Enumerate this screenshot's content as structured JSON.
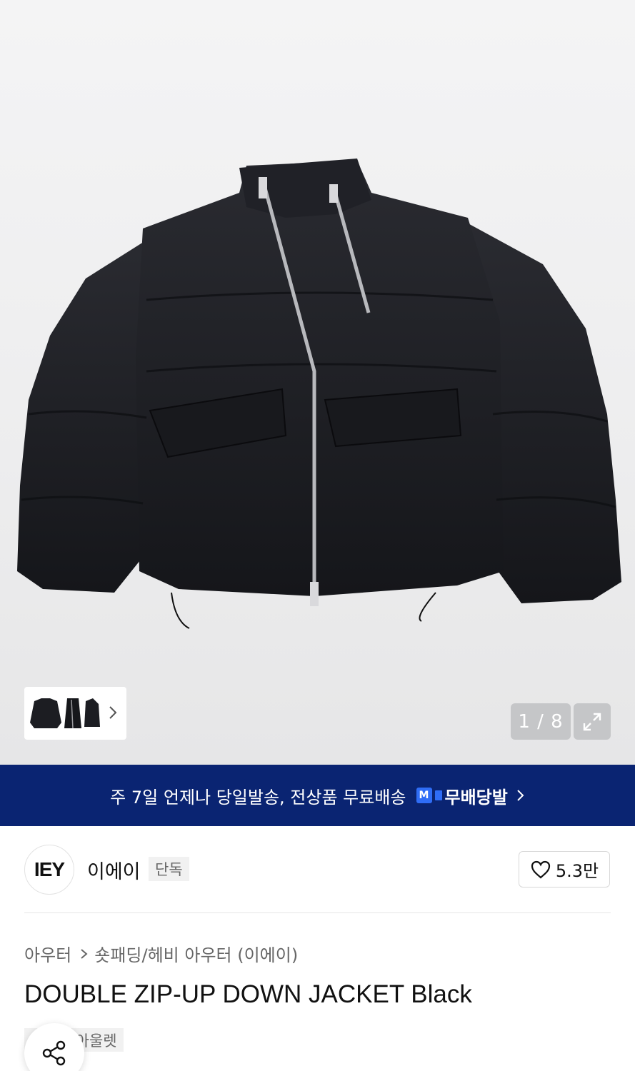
{
  "gallery": {
    "counter": "1 / 8",
    "thumbnails": [
      "thumb-front",
      "thumb-side",
      "thumb-back"
    ],
    "icons": {
      "next": "chevron-right-icon",
      "expand": "expand-icon"
    }
  },
  "banner": {
    "message": "주 7일 언제나 당일발송, 전상품 무료배송",
    "badge_letter": "M",
    "service_name": "무배당발"
  },
  "brand": {
    "logo_text": "IEY",
    "name": "이에이",
    "tag": "단독",
    "likes": "5.3만"
  },
  "product": {
    "breadcrumb": [
      "아우터",
      "숏패딩/헤비 아우터 (이에이)"
    ],
    "title": "DOUBLE ZIP-UP DOWN JACKET Black",
    "tags": [
      "단독",
      "아울렛"
    ]
  },
  "colors": {
    "banner_bg": "#0a2472",
    "badge_blue": "#2f6df6",
    "jacket": "#1c1d22"
  }
}
